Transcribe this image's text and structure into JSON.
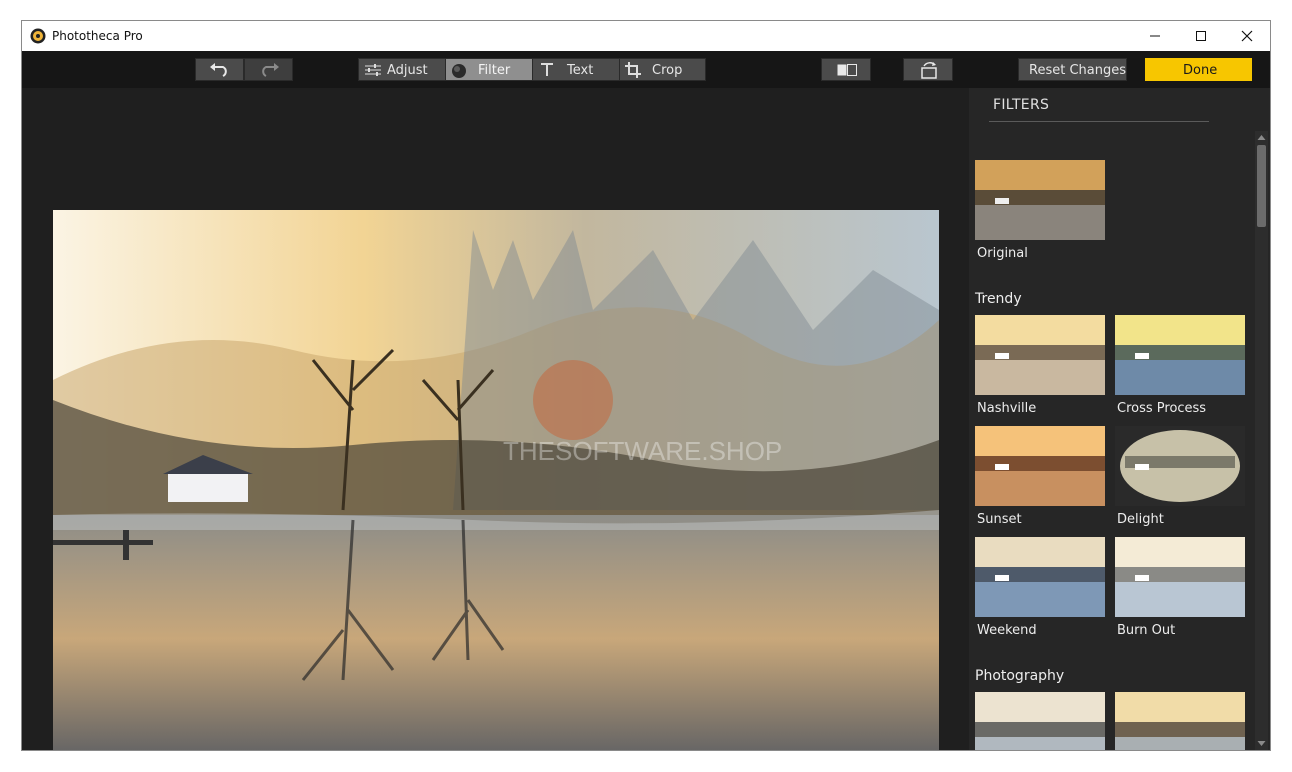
{
  "window": {
    "title": "Phototheca Pro"
  },
  "toolbar": {
    "undo": "undo-icon",
    "redo": "redo-icon",
    "tabs": [
      {
        "label": "Adjust",
        "icon": "sliders-icon",
        "active": false
      },
      {
        "label": "Filter",
        "icon": "filter-circle-icon",
        "active": true
      },
      {
        "label": "Text",
        "icon": "text-T-icon",
        "active": false
      },
      {
        "label": "Crop",
        "icon": "crop-icon",
        "active": false
      }
    ],
    "compare": "compare-icon",
    "rotate": "rotate-icon",
    "reset_label": "Reset Changes",
    "done_label": "Done"
  },
  "photo": {
    "watermark": "THESOFTWARE.SHOP"
  },
  "filters_panel": {
    "title": "FILTERS",
    "original": {
      "label": "Original"
    },
    "sections": [
      {
        "name": "Trendy",
        "items": [
          "Nashville",
          "Cross Process",
          "Sunset",
          "Delight",
          "Weekend",
          "Burn Out"
        ]
      },
      {
        "name": "Photography",
        "items": [
          "",
          ""
        ]
      }
    ]
  },
  "colors": {
    "accent_done": "#f7c600",
    "active_tab": "#8f8f8f",
    "background": "#202020"
  }
}
